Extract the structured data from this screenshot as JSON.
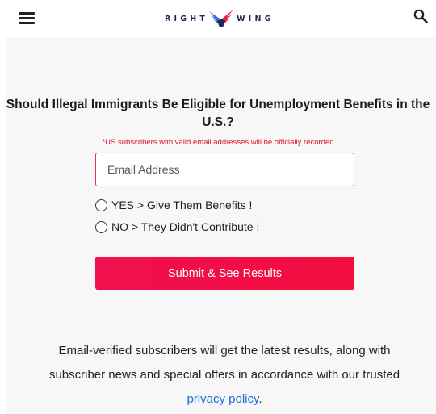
{
  "header": {
    "menu_icon": "hamburger-menu-icon",
    "logo_left": "RIGHT",
    "logo_right": "WING",
    "logo_icon": "eagle-logo-icon",
    "search_icon": "search-icon"
  },
  "poll": {
    "question": "Should Illegal Immigrants Be Eligible for Unemployment Benefits in the U.S.?",
    "notice": "*US subscribers with valid email addresses will be officially recorded",
    "email_placeholder": "Email Address",
    "options": [
      {
        "label": "YES > Give Them Benefits !"
      },
      {
        "label": "NO > They Didn't Contribute !"
      }
    ],
    "submit_label": "Submit & See Results"
  },
  "footer": {
    "text": "Email-verified subscribers will get the latest results, along with subscriber news and special offers in accordance with our trusted",
    "link_text": "privacy policy",
    "end": "."
  },
  "colors": {
    "accent": "#f0104f",
    "notice": "#e0112b",
    "link": "#1a6fd6",
    "logo_navy": "#1e2a5a",
    "panel_bg": "#f7f7f7"
  }
}
